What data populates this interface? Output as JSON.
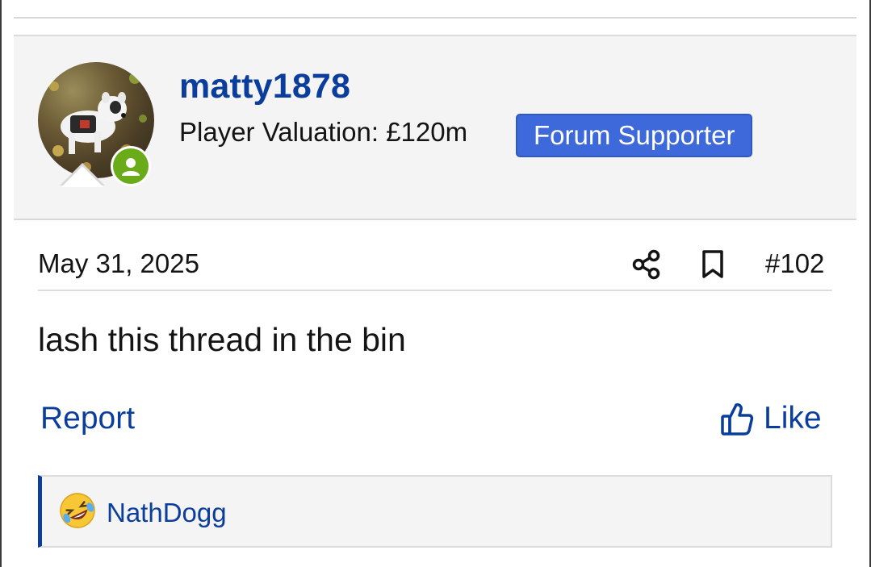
{
  "post": {
    "username": "matty1878",
    "valuation": "Player Valuation: £120m",
    "badge": "Forum Supporter",
    "date": "May 31, 2025",
    "number": "#102",
    "body": "lash this thread in the bin"
  },
  "actions": {
    "report": "Report",
    "like": "Like"
  },
  "reactions": {
    "users": "NathDogg",
    "emoji": "rolling-on-floor-laughing"
  },
  "colors": {
    "link": "#0b3e9c",
    "badge": "#3e69db",
    "online": "#6aab1a"
  }
}
